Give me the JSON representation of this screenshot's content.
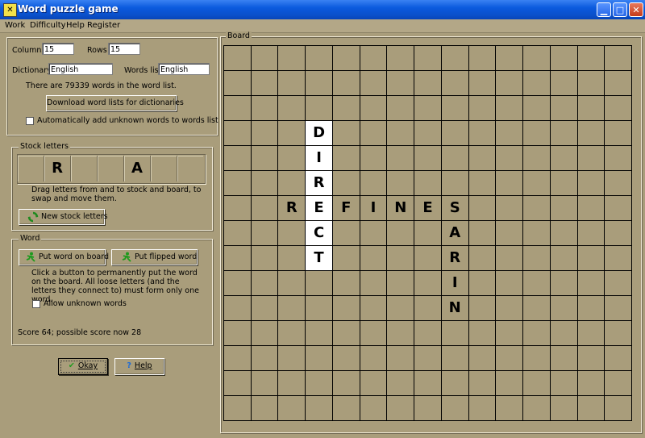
{
  "window": {
    "title": "Word puzzle game",
    "icon": "app-icon"
  },
  "menu": [
    {
      "label": "Work"
    },
    {
      "label": "Difficulty"
    },
    {
      "label": "Help"
    },
    {
      "label": "Register"
    }
  ],
  "settings": {
    "columns_label": "Columns",
    "columns_value": "15",
    "rows_label": "Rows",
    "rows_value": "15",
    "dictionary_label": "Dictionary",
    "dictionary_value": "English",
    "words_list_label": "Words list",
    "words_list_value": "English",
    "word_count_text": "There are 79339 words in the word list.",
    "download_button": "Download word lists for dictionaries",
    "auto_add_label": "Automatically add unknown words to words list",
    "auto_add_checked": false
  },
  "stock": {
    "title": "Stock letters",
    "letters": [
      "",
      "R",
      "",
      "",
      "A",
      "",
      ""
    ],
    "hint": "Drag letters from and to stock and board, to swap and move them.",
    "new_button": "New stock letters"
  },
  "word": {
    "title": "Word",
    "put_button": "Put word on board",
    "flipped_button": "Put flipped word",
    "hint": "Click a button to permanently put the word on the board. All loose letters (and the letters they connect to) must form only one word.",
    "allow_unknown_label": "Allow unknown words",
    "allow_unknown_checked": false,
    "score_text": "Score 64; possible score now 28"
  },
  "buttons": {
    "okay": "Okay",
    "help": "Help"
  },
  "board": {
    "title": "Board",
    "cols": 15,
    "rows": 15,
    "tiles": [
      {
        "r": 3,
        "c": 3,
        "ch": "D",
        "white": true
      },
      {
        "r": 4,
        "c": 3,
        "ch": "I",
        "white": true
      },
      {
        "r": 5,
        "c": 3,
        "ch": "R",
        "white": true
      },
      {
        "r": 6,
        "c": 2,
        "ch": "R",
        "white": false
      },
      {
        "r": 6,
        "c": 3,
        "ch": "E",
        "white": true
      },
      {
        "r": 6,
        "c": 4,
        "ch": "F",
        "white": false
      },
      {
        "r": 6,
        "c": 5,
        "ch": "I",
        "white": false
      },
      {
        "r": 6,
        "c": 6,
        "ch": "N",
        "white": false
      },
      {
        "r": 6,
        "c": 7,
        "ch": "E",
        "white": false
      },
      {
        "r": 6,
        "c": 8,
        "ch": "S",
        "white": false
      },
      {
        "r": 7,
        "c": 3,
        "ch": "C",
        "white": true
      },
      {
        "r": 7,
        "c": 8,
        "ch": "A",
        "white": false
      },
      {
        "r": 8,
        "c": 3,
        "ch": "T",
        "white": true
      },
      {
        "r": 8,
        "c": 8,
        "ch": "R",
        "white": false
      },
      {
        "r": 9,
        "c": 8,
        "ch": "I",
        "white": false
      },
      {
        "r": 10,
        "c": 8,
        "ch": "N",
        "white": false
      }
    ]
  },
  "colors": {
    "background": "#a99d7b",
    "grid": "#000000",
    "tile_placed": "#ffffff",
    "title_bar": "#0b5ade"
  }
}
